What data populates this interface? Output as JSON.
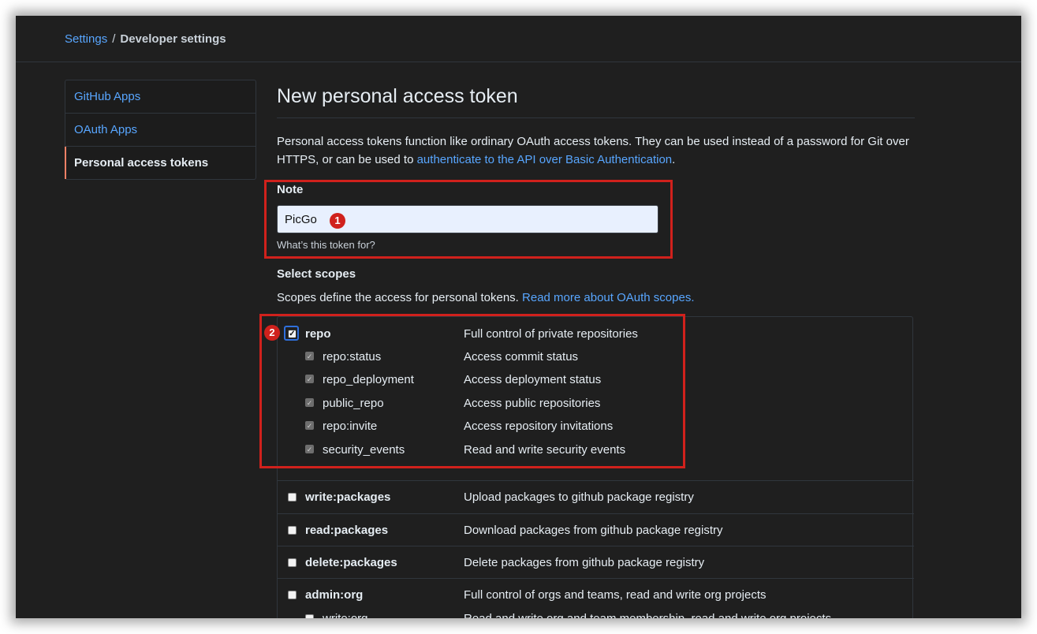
{
  "breadcrumb": {
    "settings": "Settings",
    "separator": "/",
    "current": "Developer settings"
  },
  "sidebar": {
    "items": [
      {
        "label": "GitHub Apps",
        "active": false
      },
      {
        "label": "OAuth Apps",
        "active": false
      },
      {
        "label": "Personal access tokens",
        "active": true
      }
    ]
  },
  "main": {
    "title": "New personal access token",
    "description_text": "Personal access tokens function like ordinary OAuth access tokens. They can be used instead of a password for Git over HTTPS, or can be used to",
    "description_link": "authenticate to the API over Basic Authentication",
    "description_end": ".",
    "note": {
      "label": "Note",
      "value": "PicGo",
      "hint": "What’s this token for?"
    },
    "scopes": {
      "label": "Select scopes",
      "desc_text": "Scopes define the access for personal tokens.",
      "desc_link": "Read more about OAuth scopes.",
      "rows": [
        {
          "name": "repo",
          "description": "Full control of private repositories",
          "checked": true
        },
        {
          "name": "repo:status",
          "description": "Access commit status",
          "checked": true
        },
        {
          "name": "repo_deployment",
          "description": "Access deployment status",
          "checked": true
        },
        {
          "name": "public_repo",
          "description": "Access public repositories",
          "checked": true
        },
        {
          "name": "repo:invite",
          "description": "Access repository invitations",
          "checked": true
        },
        {
          "name": "security_events",
          "description": "Read and write security events",
          "checked": true
        },
        {
          "name": "write:packages",
          "description": "Upload packages to github package registry",
          "checked": false
        },
        {
          "name": "read:packages",
          "description": "Download packages from github package registry",
          "checked": false
        },
        {
          "name": "delete:packages",
          "description": "Delete packages from github package registry",
          "checked": false
        },
        {
          "name": "admin:org",
          "description": "Full control of orgs and teams, read and write org projects",
          "checked": false
        },
        {
          "name": "write:org",
          "description": "Read and write org and team membership, read and write org projects",
          "checked": false
        }
      ]
    }
  },
  "annotations": {
    "marker_1": "1",
    "marker_2": "2",
    "color": "#d0211c"
  },
  "colors": {
    "link": "#58a6ff",
    "background": "#1f1f1f",
    "active_indicator": "#f78166"
  }
}
